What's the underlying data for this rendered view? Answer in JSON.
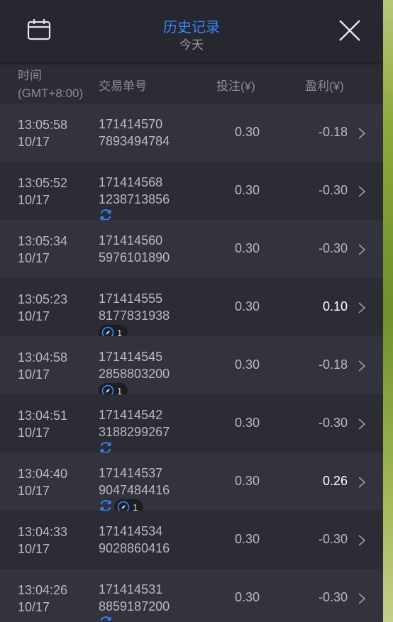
{
  "header": {
    "title": "历史记录",
    "subtitle": "今天"
  },
  "columns": {
    "time": "时间",
    "timezone": "(GMT+8:00)",
    "order": "交易单号",
    "bet": "投注(¥)",
    "profit": "盈利(¥)"
  },
  "rows": [
    {
      "time": "13:05:58",
      "date": "10/17",
      "order1": "171414570",
      "order2": "7893494784",
      "bet": "0.30",
      "profit": "-0.18",
      "sync": false,
      "badge": ""
    },
    {
      "time": "13:05:52",
      "date": "10/17",
      "order1": "171414568",
      "order2": "1238713856",
      "bet": "0.30",
      "profit": "-0.30",
      "sync": true,
      "badge": ""
    },
    {
      "time": "13:05:34",
      "date": "10/17",
      "order1": "171414560",
      "order2": "5976101890",
      "bet": "0.30",
      "profit": "-0.30",
      "sync": false,
      "badge": ""
    },
    {
      "time": "13:05:23",
      "date": "10/17",
      "order1": "171414555",
      "order2": "8177831938",
      "bet": "0.30",
      "profit": "0.10",
      "sync": false,
      "badge": "1"
    },
    {
      "time": "13:04:58",
      "date": "10/17",
      "order1": "171414545",
      "order2": "2858803200",
      "bet": "0.30",
      "profit": "-0.18",
      "sync": false,
      "badge": "1"
    },
    {
      "time": "13:04:51",
      "date": "10/17",
      "order1": "171414542",
      "order2": "3188299267",
      "bet": "0.30",
      "profit": "-0.30",
      "sync": true,
      "badge": ""
    },
    {
      "time": "13:04:40",
      "date": "10/17",
      "order1": "171414537",
      "order2": "9047484416",
      "bet": "0.30",
      "profit": "0.26",
      "sync": true,
      "badge": "1"
    },
    {
      "time": "13:04:33",
      "date": "10/17",
      "order1": "171414534",
      "order2": "9028860416",
      "bet": "0.30",
      "profit": "-0.30",
      "sync": false,
      "badge": ""
    },
    {
      "time": "13:04:26",
      "date": "10/17",
      "order1": "171414531",
      "order2": "8859187200",
      "bet": "0.30",
      "profit": "-0.30",
      "sync": true,
      "badge": ""
    }
  ],
  "colors": {
    "accent": "#3a86ff",
    "background": "#2b2c34"
  }
}
